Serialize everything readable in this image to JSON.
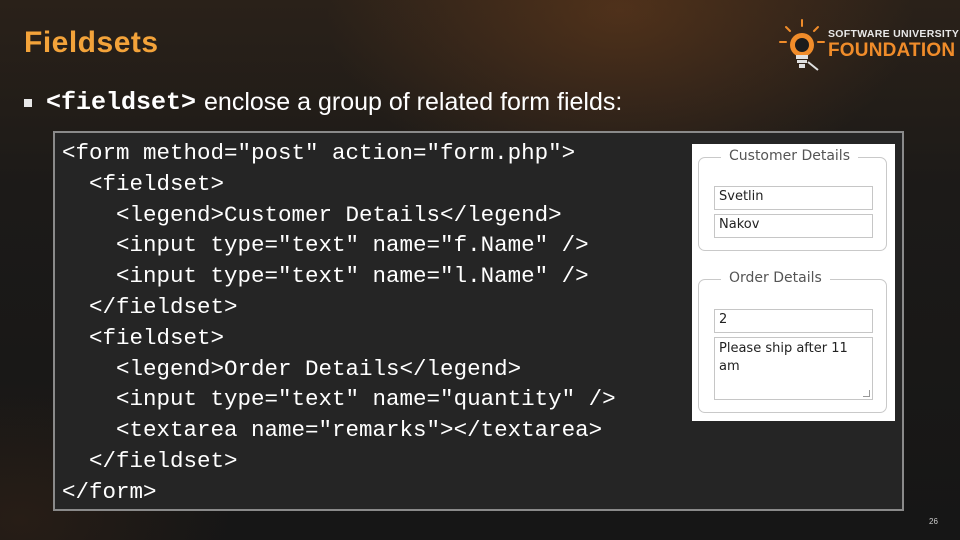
{
  "slide": {
    "title": "Fieldsets",
    "page_number": "26"
  },
  "logo": {
    "line1": "SOFTWARE UNIVERSITY",
    "line2": "FOUNDATION"
  },
  "bullet": {
    "code": "<fieldset>",
    "text": "enclose a group of related form fields:"
  },
  "code_lines": [
    "<form method=\"post\" action=\"form.php\">",
    "  <fieldset>",
    "    <legend>Customer Details</legend>",
    "    <input type=\"text\" name=\"f.Name\" />",
    "    <input type=\"text\" name=\"l.Name\" />",
    "  </fieldset>",
    "  <fieldset>",
    "    <legend>Order Details</legend>",
    "    <input type=\"text\" name=\"quantity\" />",
    "    <textarea name=\"remarks\"></textarea>",
    "  </fieldset>",
    "</form>"
  ],
  "demo_form": {
    "customer_legend": "Customer Details",
    "first_name": "Svetlin",
    "last_name": "Nakov",
    "order_legend": "Order Details",
    "quantity": "2",
    "remarks": "Please ship after 11 am"
  },
  "colors": {
    "title": "#f3a33a",
    "logo_accent": "#f08c2a",
    "background": "#1b1b1b",
    "code_panel": "#252525"
  }
}
